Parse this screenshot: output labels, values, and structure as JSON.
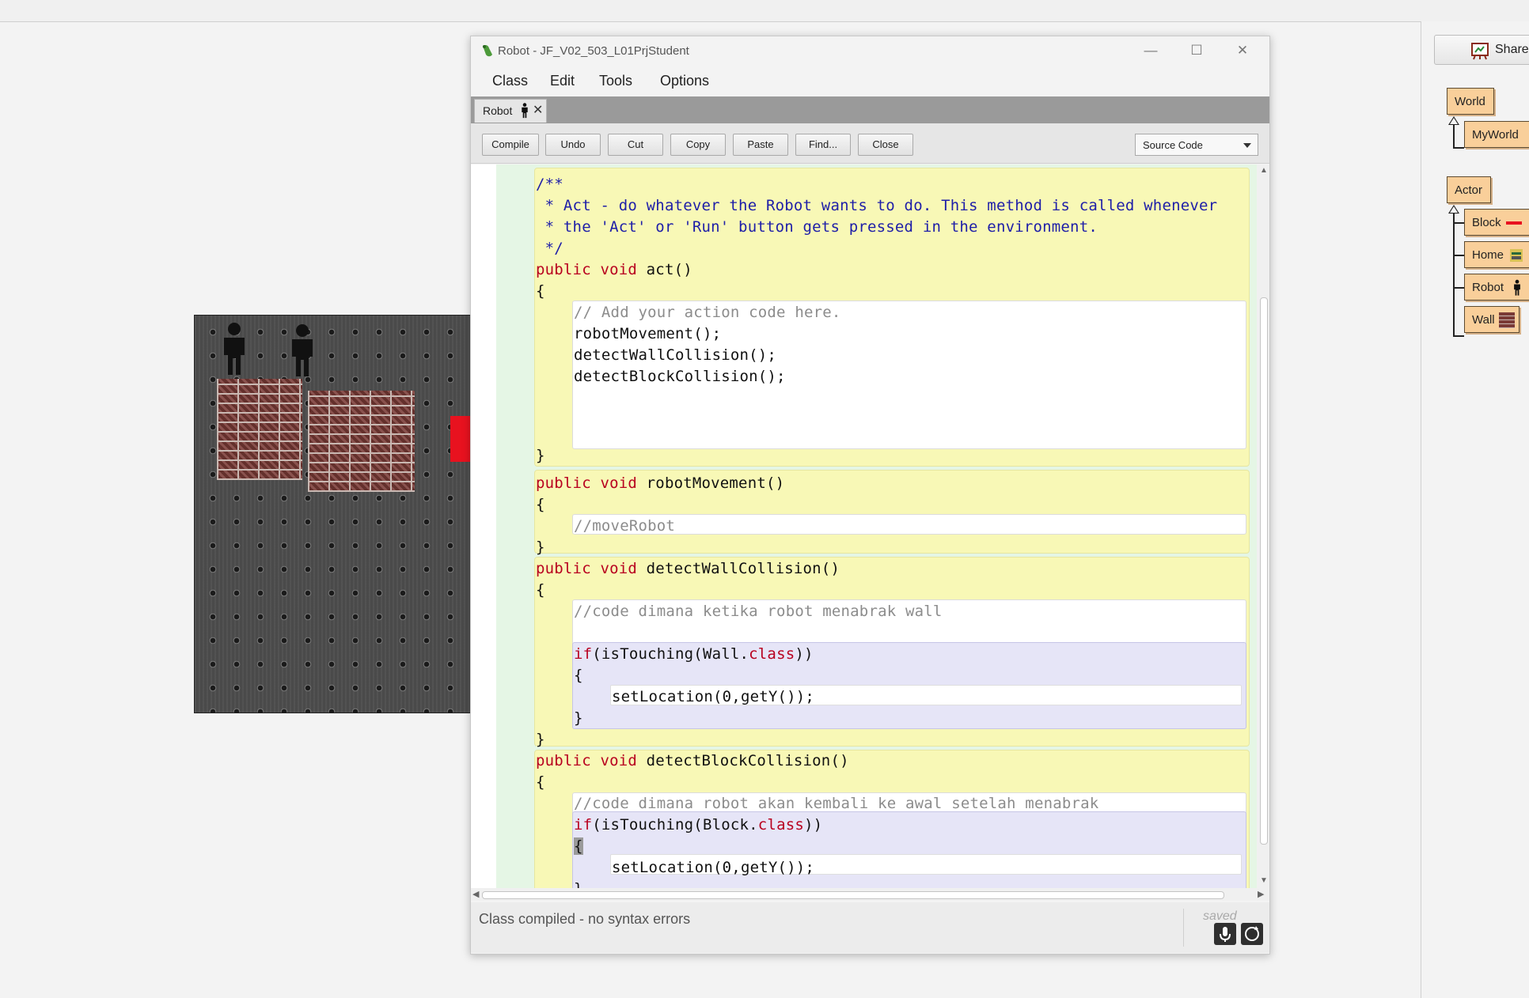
{
  "window": {
    "title": "Robot - JF_V02_503_L01PrjStudent",
    "minimize_glyph": "—",
    "maximize_glyph": "☐",
    "close_glyph": "✕"
  },
  "menu": [
    "Class",
    "Edit",
    "Tools",
    "Options"
  ],
  "tab": {
    "label": "Robot",
    "close_glyph": "✕",
    "icon": "robot-person-icon"
  },
  "toolbar": {
    "compile": "Compile",
    "undo": "Undo",
    "cut": "Cut",
    "copy": "Copy",
    "paste": "Paste",
    "find": "Find...",
    "close": "Close",
    "view_selector": "Source Code"
  },
  "code": {
    "doc1": "/**",
    "doc2": " * Act - do whatever the Robot wants to do. This method is called whenever",
    "doc3": " * the 'Act' or 'Run' button gets pressed in the environment.",
    "doc4": " */",
    "act_kw": "public void",
    "act_name": " act()",
    "brace_open": "{",
    "brace_close": "}",
    "act_c1": "// Add your action code here.",
    "act_l1": "robotMovement();",
    "act_l2": "detectWallCollision();",
    "act_l3": "detectBlockCollision();",
    "rm_name": " robotMovement()",
    "rm_c1": "//moveRobot",
    "dw_name": " detectWallCollision()",
    "dw_c1": "//code dimana ketika robot menabrak wall",
    "dw_if_a": "if",
    "dw_if_b": "(isTouching(Wall.",
    "kw_class": "class",
    "if_end": "))",
    "set_loc": "setLocation(0,getY());",
    "db_name": " detectBlockCollision()",
    "db_c1": "//code dimana robot akan kembali ke awal setelah menabrak",
    "db_if_b": "(isTouching(Block."
  },
  "status": {
    "message": "Class compiled - no syntax errors",
    "saved": "saved"
  },
  "class_diagram": {
    "share": "Share",
    "world": "World",
    "myworld": "MyWorld",
    "actor": "Actor",
    "subclasses": [
      "Block",
      "Home",
      "Robot",
      "Wall"
    ]
  },
  "colors": {
    "method_scope": "#f8f8b6",
    "class_scope": "#e5f6e5",
    "if_scope": "#e6e5f7",
    "class_box": "#f9cf9a",
    "keyword": "#b8001f",
    "doc_comment": "#1e1ea8",
    "block_red": "#e8121f"
  }
}
